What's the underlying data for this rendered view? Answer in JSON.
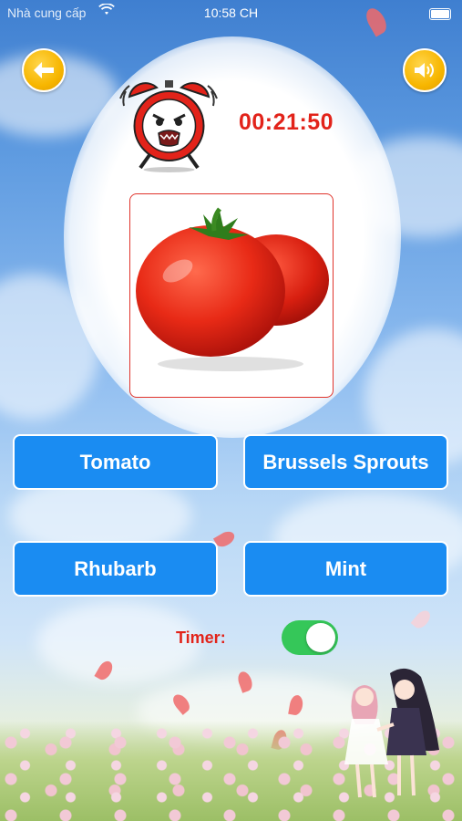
{
  "status_bar": {
    "carrier": "Nhà cung cấp",
    "time": "10:58 CH"
  },
  "header": {
    "back_icon": "arrow-left-icon",
    "sound_icon": "speaker-icon",
    "alarm_icon": "alarm-clock-icon",
    "timer": "00:21:50"
  },
  "question": {
    "image": "tomato"
  },
  "answers": [
    {
      "label": "Tomato"
    },
    {
      "label": "Brussels Sprouts"
    },
    {
      "label": "Rhubarb"
    },
    {
      "label": "Mint"
    }
  ],
  "timer_setting": {
    "label": "Timer:",
    "enabled": true
  },
  "colors": {
    "answer_button": "#1a8cf2",
    "accent_red": "#e2231a",
    "toggle_on": "#35c759",
    "round_button": "#f7b600"
  }
}
